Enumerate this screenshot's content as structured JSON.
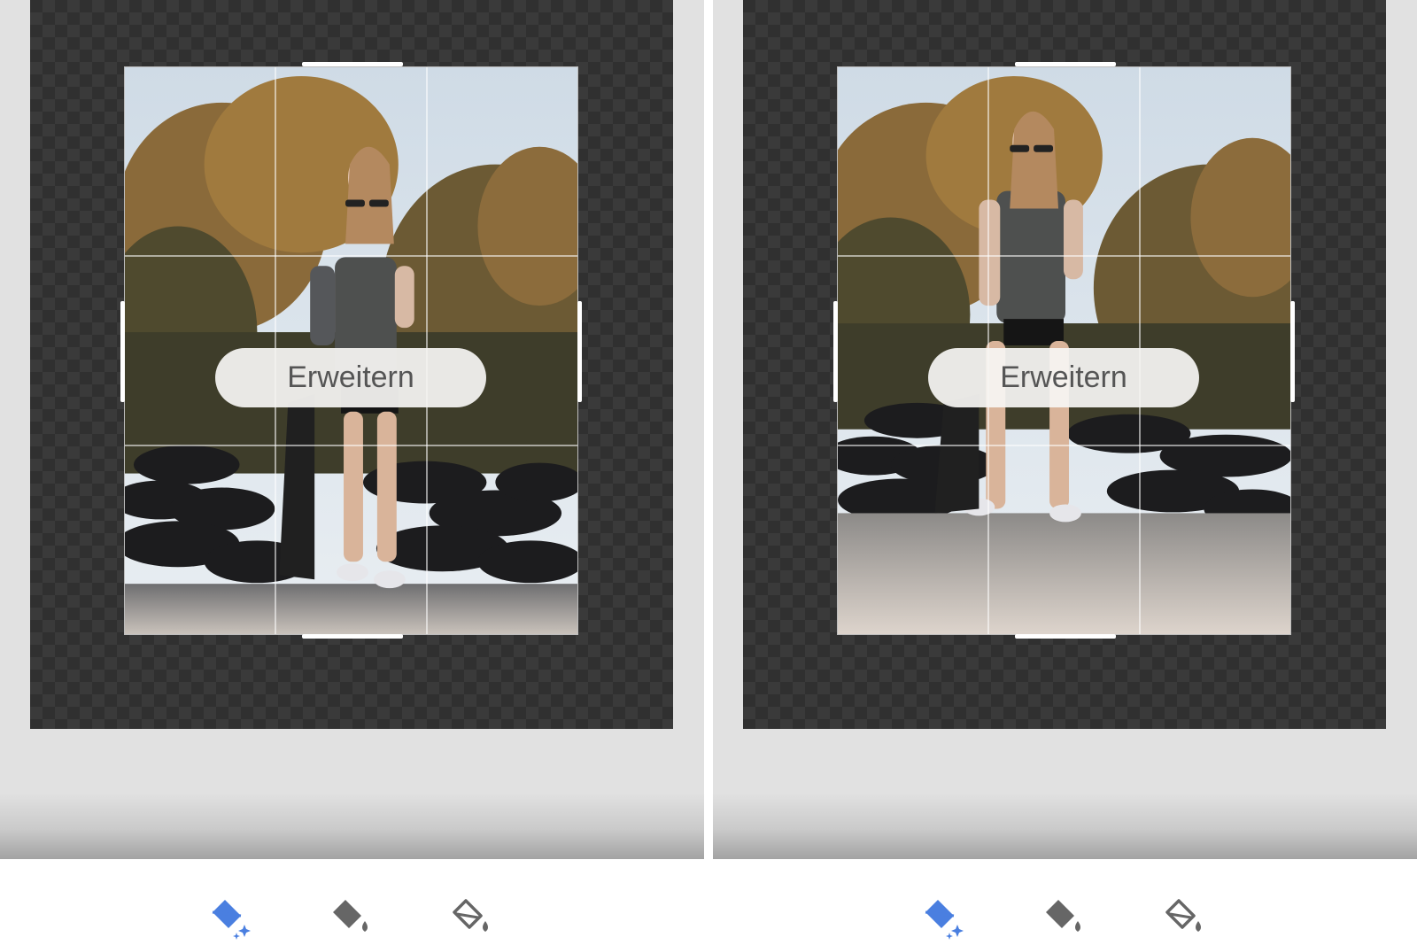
{
  "colors": {
    "accent": "#4a7fe0",
    "icon_inactive": "#666666",
    "canvas_bg": "#303030",
    "panel_bg": "#e1e1e1"
  },
  "left_panel": {
    "expand_label": "Erweitern",
    "tools": [
      {
        "name": "magic-fill-bucket-icon",
        "active": true
      },
      {
        "name": "fill-bucket-icon",
        "active": false
      },
      {
        "name": "outline-fill-bucket-icon",
        "active": false
      }
    ]
  },
  "right_panel": {
    "expand_label": "Erweitern",
    "tools": [
      {
        "name": "magic-fill-bucket-icon",
        "active": true
      },
      {
        "name": "fill-bucket-icon",
        "active": false
      },
      {
        "name": "outline-fill-bucket-icon",
        "active": false
      }
    ]
  }
}
